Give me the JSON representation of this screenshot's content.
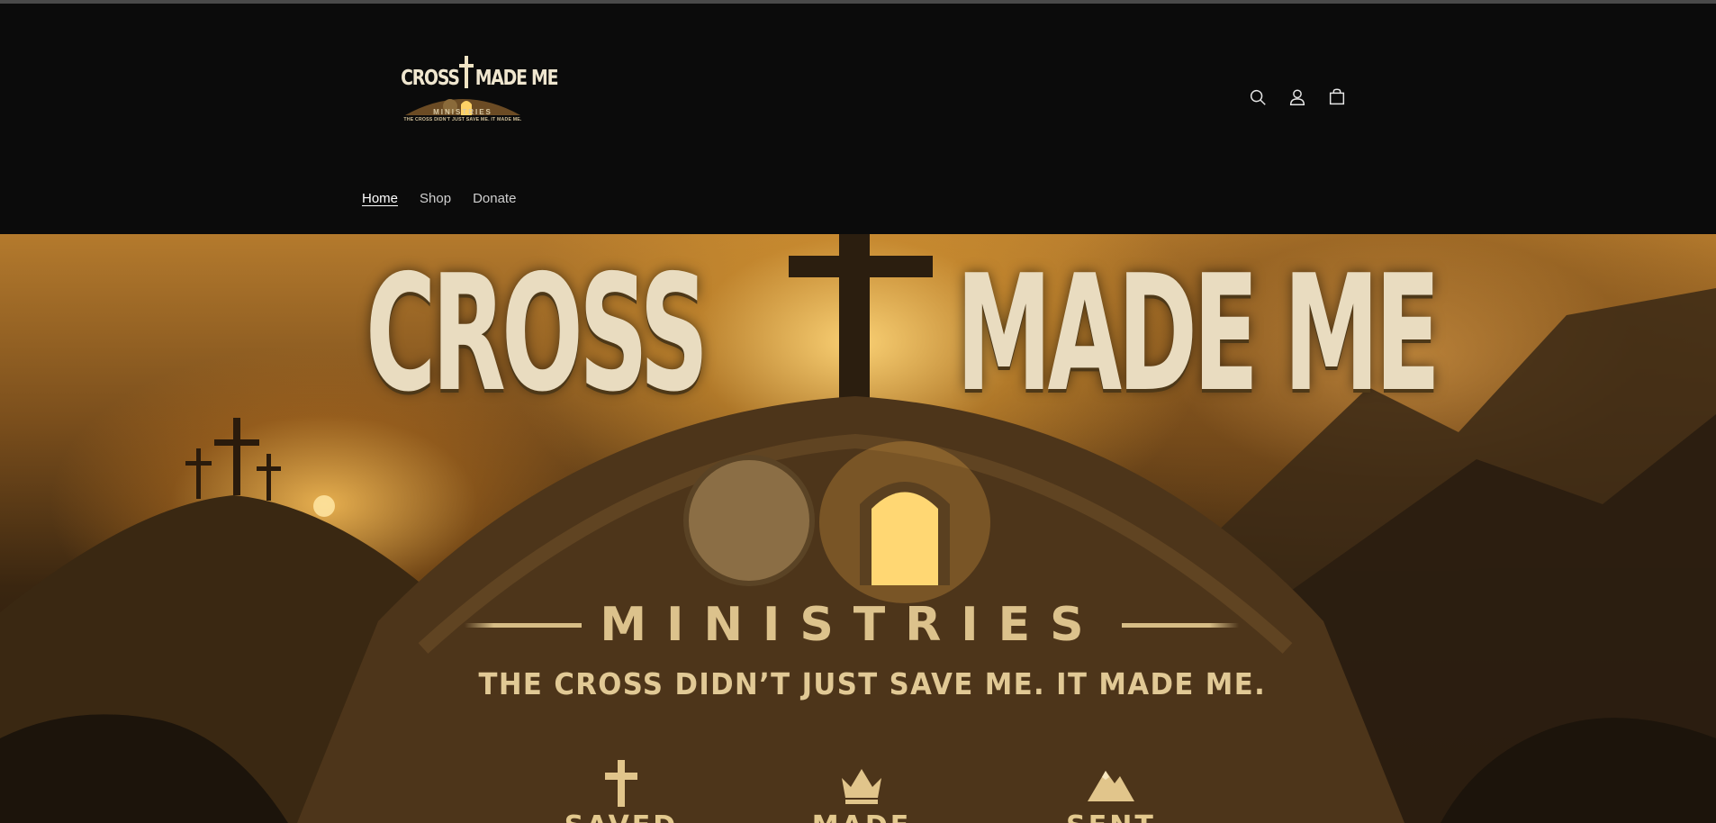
{
  "header": {
    "logo": {
      "title_left": "CROSS",
      "title_right": "MADE ME",
      "subtitle": "MINISTRIES",
      "tagline": "THE CROSS DIDN'T JUST SAVE ME. IT MADE ME."
    },
    "icons": [
      "search-icon",
      "account-icon",
      "cart-icon"
    ],
    "nav": [
      {
        "label": "Home",
        "active": true
      },
      {
        "label": "Shop",
        "active": false
      },
      {
        "label": "Donate",
        "active": false
      }
    ]
  },
  "hero": {
    "title_left": "CROSS",
    "title_right": "MADE ME",
    "subtitle": "MINISTRIES",
    "tagline": "THE CROSS DIDN’T JUST SAVE ME. IT MADE ME.",
    "pillars": [
      {
        "icon": "cross-icon",
        "label": "SAVED"
      },
      {
        "icon": "crown-icon",
        "label": "MADE"
      },
      {
        "icon": "mountain-icon",
        "label": "SENT"
      }
    ]
  },
  "colors": {
    "page_background": "#0b0b0b",
    "hero_gold": "#dcc28c",
    "hero_text": "#e9dcc0"
  }
}
